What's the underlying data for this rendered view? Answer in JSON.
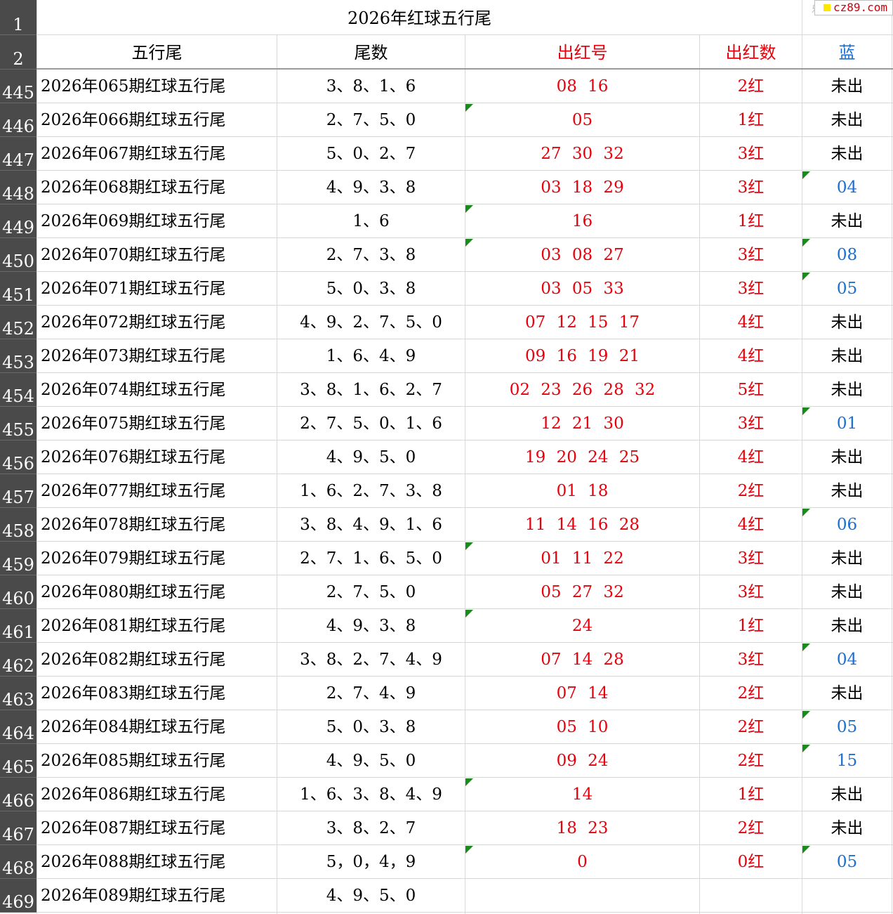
{
  "sheet": {
    "title": "2026年红球五行尾",
    "title_row_number": "1",
    "header_row_number": "2",
    "headers": {
      "name": "五行尾",
      "tail": "尾数",
      "red": "出红号",
      "count": "出红数",
      "blue": "蓝"
    },
    "brand": "cz89.com",
    "brand_ghost": "乐",
    "colors": {
      "red": "#e8000b",
      "blue": "#1a6fd4",
      "black": "#000000",
      "rowhead_bg": "#4a4a4a",
      "comment_marker": "#1a8a1a"
    },
    "rows": [
      {
        "num": "445",
        "name": "2026年065期红球五行尾",
        "tail": "3、8、1、6",
        "red": "08 16",
        "count": "2红",
        "blue": "未出",
        "red_marker": false,
        "blue_marker": false
      },
      {
        "num": "446",
        "name": "2026年066期红球五行尾",
        "tail": "2、7、5、0",
        "red": "05",
        "count": "1红",
        "blue": "未出",
        "red_marker": true,
        "blue_marker": false
      },
      {
        "num": "447",
        "name": "2026年067期红球五行尾",
        "tail": "5、0、2、7",
        "red": "27 30 32",
        "count": "3红",
        "blue": "未出",
        "red_marker": false,
        "blue_marker": false
      },
      {
        "num": "448",
        "name": "2026年068期红球五行尾",
        "tail": "4、9、3、8",
        "red": "03 18 29",
        "count": "3红",
        "blue": "04",
        "red_marker": false,
        "blue_marker": true
      },
      {
        "num": "449",
        "name": "2026年069期红球五行尾",
        "tail": "1、6",
        "red": "16",
        "count": "1红",
        "blue": "未出",
        "red_marker": true,
        "blue_marker": false
      },
      {
        "num": "450",
        "name": "2026年070期红球五行尾",
        "tail": "2、7、3、8",
        "red": "03 08 27",
        "count": "3红",
        "blue": "08",
        "red_marker": true,
        "blue_marker": true
      },
      {
        "num": "451",
        "name": "2026年071期红球五行尾",
        "tail": "5、0、3、8",
        "red": "03 05 33",
        "count": "3红",
        "blue": "05",
        "red_marker": false,
        "blue_marker": true
      },
      {
        "num": "452",
        "name": "2026年072期红球五行尾",
        "tail": "4、9、2、7、5、0",
        "red": "07 12 15 17",
        "count": "4红",
        "blue": "未出",
        "red_marker": false,
        "blue_marker": false
      },
      {
        "num": "453",
        "name": "2026年073期红球五行尾",
        "tail": "1、6、4、9",
        "red": "09 16 19 21",
        "count": "4红",
        "blue": "未出",
        "red_marker": false,
        "blue_marker": false
      },
      {
        "num": "454",
        "name": "2026年074期红球五行尾",
        "tail": "3、8、1、6、2、7",
        "red": "02 23 26 28 32",
        "count": "5红",
        "blue": "未出",
        "red_marker": false,
        "blue_marker": false
      },
      {
        "num": "455",
        "name": "2026年075期红球五行尾",
        "tail": "2、7、5、0、1、6",
        "red": "12 21 30",
        "count": "3红",
        "blue": "01",
        "red_marker": false,
        "blue_marker": true
      },
      {
        "num": "456",
        "name": "2026年076期红球五行尾",
        "tail": "4、9、5、0",
        "red": "19 20 24 25",
        "count": "4红",
        "blue": "未出",
        "red_marker": false,
        "blue_marker": false
      },
      {
        "num": "457",
        "name": "2026年077期红球五行尾",
        "tail": "1、6、2、7、3、8",
        "red": "01 18",
        "count": "2红",
        "blue": "未出",
        "red_marker": false,
        "blue_marker": false
      },
      {
        "num": "458",
        "name": "2026年078期红球五行尾",
        "tail": "3、8、4、9、1、6",
        "red": "11 14 16 28",
        "count": "4红",
        "blue": "06",
        "red_marker": false,
        "blue_marker": true
      },
      {
        "num": "459",
        "name": "2026年079期红球五行尾",
        "tail": "2、7、1、6、5、0",
        "red": "01 11 22",
        "count": "3红",
        "blue": "未出",
        "red_marker": true,
        "blue_marker": false
      },
      {
        "num": "460",
        "name": "2026年080期红球五行尾",
        "tail": "2、7、5、0",
        "red": "05 27 32",
        "count": "3红",
        "blue": "未出",
        "red_marker": false,
        "blue_marker": false
      },
      {
        "num": "461",
        "name": "2026年081期红球五行尾",
        "tail": "4、9、3、8",
        "red": "24",
        "count": "1红",
        "blue": "未出",
        "red_marker": true,
        "blue_marker": false
      },
      {
        "num": "462",
        "name": "2026年082期红球五行尾",
        "tail": "3、8、2、7、4、9",
        "red": "07 14 28",
        "count": "3红",
        "blue": "04",
        "red_marker": false,
        "blue_marker": true
      },
      {
        "num": "463",
        "name": "2026年083期红球五行尾",
        "tail": "2、7、4、9",
        "red": "07 14",
        "count": "2红",
        "blue": "未出",
        "red_marker": false,
        "blue_marker": false
      },
      {
        "num": "464",
        "name": "2026年084期红球五行尾",
        "tail": "5、0、3、8",
        "red": "05 10",
        "count": "2红",
        "blue": "05",
        "red_marker": false,
        "blue_marker": true
      },
      {
        "num": "465",
        "name": "2026年085期红球五行尾",
        "tail": "4、9、5、0",
        "red": "09 24",
        "count": "2红",
        "blue": "15",
        "red_marker": false,
        "blue_marker": true
      },
      {
        "num": "466",
        "name": "2026年086期红球五行尾",
        "tail": "1、6、3、8、4、9",
        "red": "14",
        "count": "1红",
        "blue": "未出",
        "red_marker": true,
        "blue_marker": false
      },
      {
        "num": "467",
        "name": "2026年087期红球五行尾",
        "tail": "3、8、2、7",
        "red": "18 23",
        "count": "2红",
        "blue": "未出",
        "red_marker": false,
        "blue_marker": false
      },
      {
        "num": "468",
        "name": "2026年088期红球五行尾",
        "tail": "5，0，4，9",
        "red": "0",
        "count": "0红",
        "blue": "05",
        "red_marker": true,
        "blue_marker": true
      },
      {
        "num": "469",
        "name": "2026年089期红球五行尾",
        "tail": "4、9、5、0",
        "red": "",
        "count": "",
        "blue": "",
        "red_marker": false,
        "blue_marker": false
      }
    ]
  }
}
